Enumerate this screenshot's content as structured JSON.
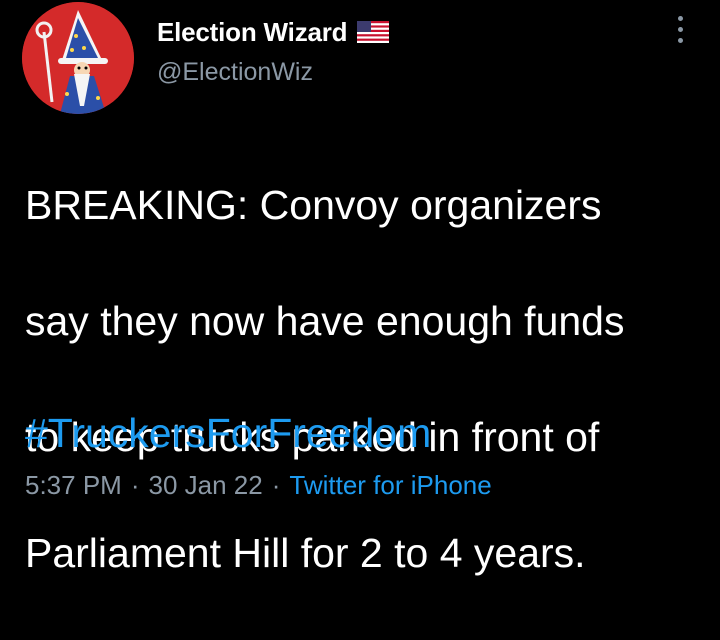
{
  "author": {
    "display_name": "Election Wizard",
    "handle": "@ElectionWiz",
    "flag_icon": "us-flag-icon",
    "avatar_icon": "wizard-avatar-icon"
  },
  "tweet": {
    "text_lines": [
      "BREAKING: Convoy organizers",
      "say they now have enough funds",
      "to keep trucks parked in front of",
      "Parliament Hill for 2 to 4 years."
    ],
    "hashtag": "#TruckersForFreedom"
  },
  "meta": {
    "time": "5:37 PM",
    "separator": "·",
    "date": "30 Jan 22",
    "source": "Twitter for iPhone"
  },
  "menu": {
    "icon": "more-options-icon"
  },
  "colors": {
    "background": "#000000",
    "text": "#ffffff",
    "secondary": "#8b98a5",
    "accent": "#1d9bf0",
    "avatar": "#d42a2a"
  }
}
